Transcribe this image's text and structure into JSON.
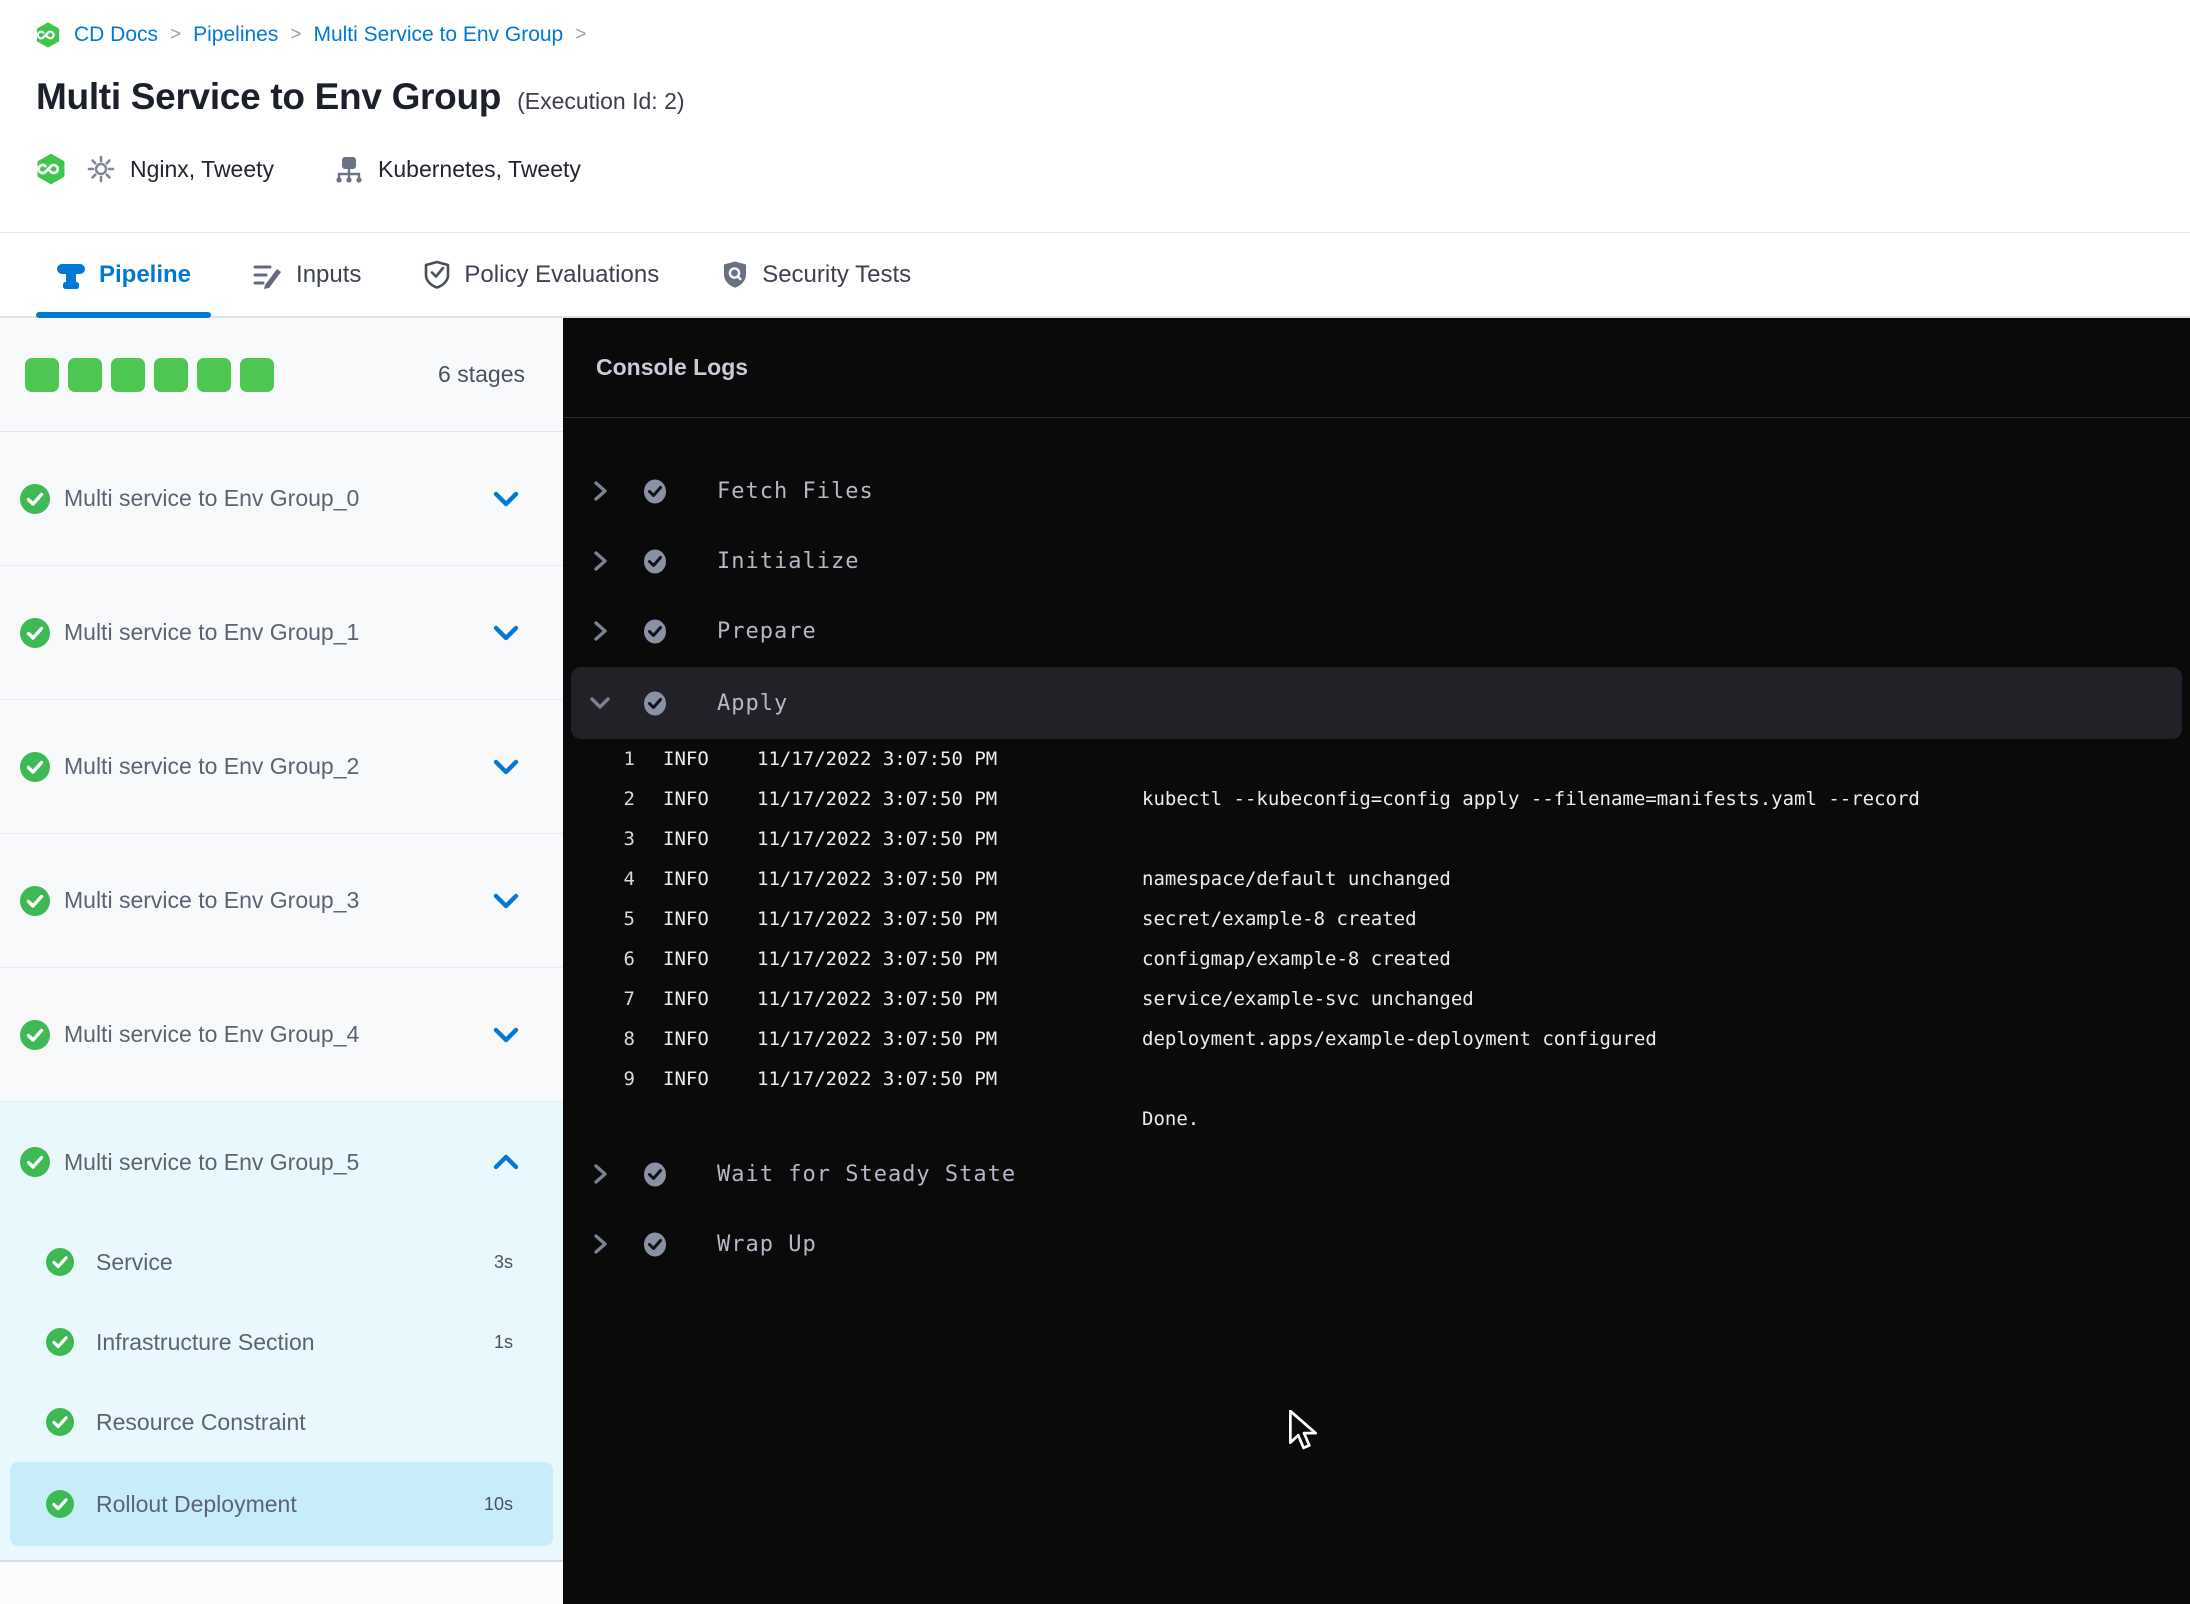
{
  "colors": {
    "accent_blue": "#0278d5",
    "success_green": "#3eba54",
    "square_green": "#4dc652",
    "expanded_bg": "#e9f8fd",
    "selected_step_bg": "#c7ecfa",
    "console_bg": "#0a0a0b",
    "console_row_highlight": "#212127"
  },
  "breadcrumb": {
    "items": [
      "CD Docs",
      "Pipelines",
      "Multi Service to Env Group"
    ],
    "separator": ">"
  },
  "header": {
    "title": "Multi Service to Env Group",
    "execution_id": "(Execution Id: 2)",
    "services_label": "Nginx, Tweety",
    "infrastructure_label": "Kubernetes, Tweety"
  },
  "tabs": [
    {
      "label": "Pipeline",
      "active": true
    },
    {
      "label": "Inputs",
      "active": false
    },
    {
      "label": "Policy Evaluations",
      "active": false
    },
    {
      "label": "Security Tests",
      "active": false
    }
  ],
  "stages_panel": {
    "stage_count_label": "6 stages",
    "square_count": 6,
    "collapsed_stages": [
      {
        "label": "Multi service to Env Group_0"
      },
      {
        "label": "Multi service to Env Group_1"
      },
      {
        "label": "Multi service to Env Group_2"
      },
      {
        "label": "Multi service to Env Group_3"
      },
      {
        "label": "Multi service to Env Group_4"
      }
    ],
    "expanded_stage": {
      "label": "Multi service to Env Group_5",
      "steps": [
        {
          "label": "Service",
          "duration": "3s",
          "selected": false
        },
        {
          "label": "Infrastructure Section",
          "duration": "1s",
          "selected": false
        },
        {
          "label": "Resource Constraint",
          "duration": "",
          "selected": false
        },
        {
          "label": "Rollout Deployment",
          "duration": "10s",
          "selected": true
        }
      ]
    }
  },
  "console": {
    "title": "Console Logs",
    "sections": [
      {
        "label": "Fetch Files",
        "expanded": false
      },
      {
        "label": "Initialize",
        "expanded": false
      },
      {
        "label": "Prepare",
        "expanded": false
      },
      {
        "label": "Apply",
        "expanded": true
      },
      {
        "label": "Wait for Steady State",
        "expanded": false
      },
      {
        "label": "Wrap Up",
        "expanded": false
      }
    ],
    "log_lines": [
      {
        "n": "1",
        "level": "INFO",
        "time": "11/17/2022 3:07:50 PM",
        "msg": ""
      },
      {
        "n": "2",
        "level": "INFO",
        "time": "11/17/2022 3:07:50 PM",
        "msg": "kubectl --kubeconfig=config apply --filename=manifests.yaml --record"
      },
      {
        "n": "3",
        "level": "INFO",
        "time": "11/17/2022 3:07:50 PM",
        "msg": ""
      },
      {
        "n": "4",
        "level": "INFO",
        "time": "11/17/2022 3:07:50 PM",
        "msg": "namespace/default unchanged"
      },
      {
        "n": "5",
        "level": "INFO",
        "time": "11/17/2022 3:07:50 PM",
        "msg": "secret/example-8 created"
      },
      {
        "n": "6",
        "level": "INFO",
        "time": "11/17/2022 3:07:50 PM",
        "msg": "configmap/example-8 created"
      },
      {
        "n": "7",
        "level": "INFO",
        "time": "11/17/2022 3:07:50 PM",
        "msg": "service/example-svc unchanged"
      },
      {
        "n": "8",
        "level": "INFO",
        "time": "11/17/2022 3:07:50 PM",
        "msg": "deployment.apps/example-deployment configured"
      },
      {
        "n": "9",
        "level": "INFO",
        "time": "11/17/2022 3:07:50 PM",
        "msg": ""
      }
    ],
    "footer_line": "Done."
  }
}
